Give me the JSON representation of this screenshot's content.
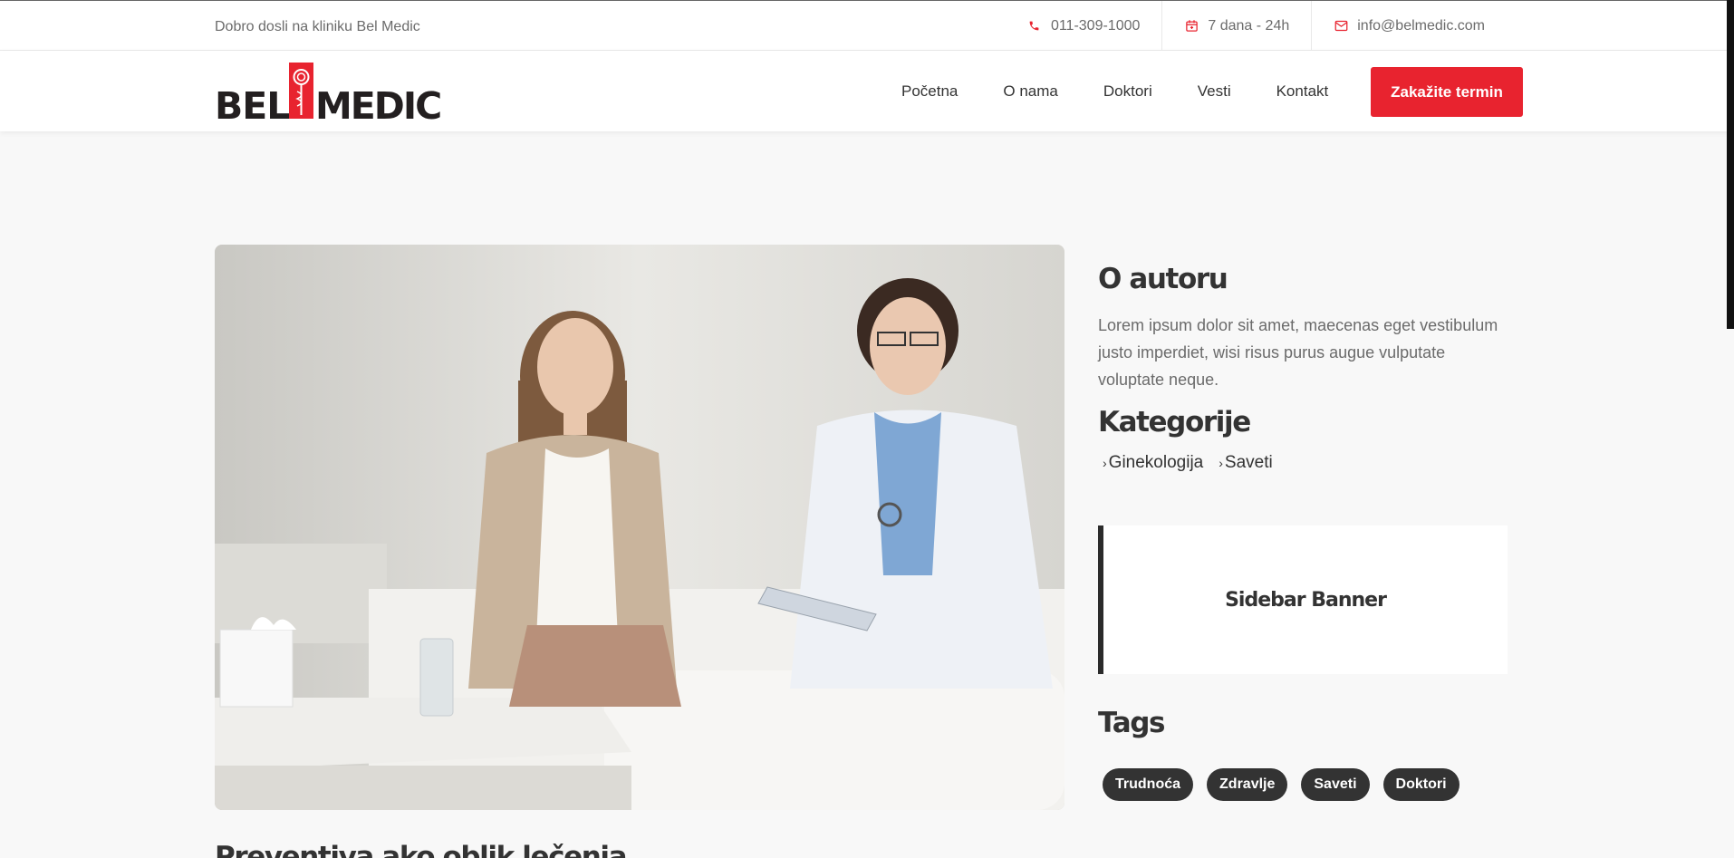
{
  "topbar": {
    "welcome": "Dobro dosli na kliniku Bel Medic",
    "phone": "011-309-1000",
    "hours": "7 dana - 24h",
    "email": "info@belmedic.com"
  },
  "logo": {
    "left": "BEL",
    "right": "MEDIC"
  },
  "nav": {
    "items": [
      "Početna",
      "O nama",
      "Doktori",
      "Vesti",
      "Kontakt"
    ],
    "cta": "Zakažite termin"
  },
  "sidebar": {
    "about_title": "O autoru",
    "about_text": "Lorem ipsum dolor sit amet, maecenas eget vestibulum justo imperdiet, wisi risus purus augue vulputate voluptate neque.",
    "categories_title": "Kategorije",
    "categories": [
      "Ginekologija",
      "Saveti"
    ],
    "banner": "Sidebar Banner",
    "tags_title": "Tags",
    "tags": [
      "Trudnoća",
      "Zdravlje",
      "Saveti",
      "Doktori"
    ]
  },
  "post": {
    "title": "Preventiva ako oblik lečenja"
  },
  "colors": {
    "accent": "#e8232f",
    "dark": "#333333",
    "muted": "#6b6b6b"
  }
}
